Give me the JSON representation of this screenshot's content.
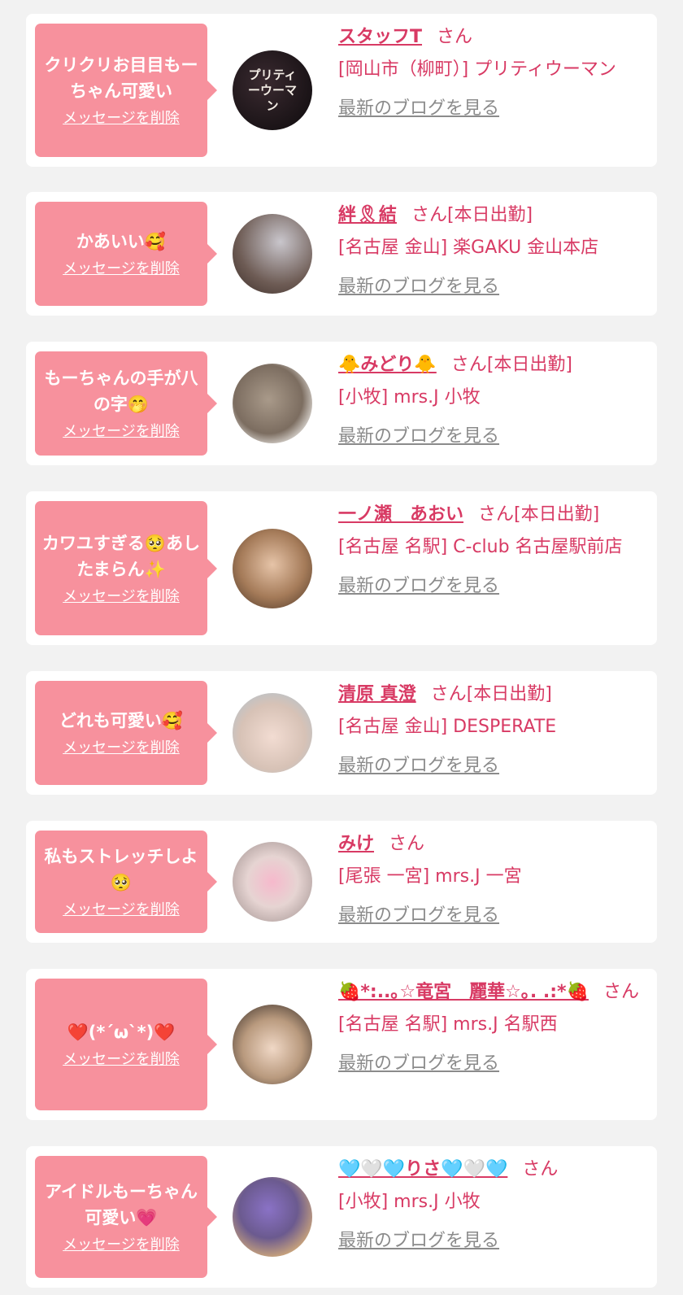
{
  "colors": {
    "bubble": "#f7919d",
    "accent": "#d83a64",
    "link_gray": "#8b8b8b",
    "background": "#f2f2f2",
    "card": "#ffffff"
  },
  "cards": [
    {
      "message": "クリクリお目目もーちゃん可愛い",
      "delete_label": "メッセージを削除",
      "name": "スタッフT",
      "suffix": "さん",
      "status": "",
      "shop": "[岡山市（柳町）] プリティウーマン",
      "blog_label": "最新のブログを見る",
      "avatar_label": "プリティーウーマン"
    },
    {
      "message": "かあいい🥰",
      "delete_label": "メッセージを削除",
      "name": "絆🎗結",
      "suffix": "さん",
      "status": "[本日出勤]",
      "shop": "[名古屋 金山] 楽GAKU 金山本店",
      "blog_label": "最新のブログを見る"
    },
    {
      "message": "もーちゃんの手が八の字🤭",
      "delete_label": "メッセージを削除",
      "name": "🐥みどり🐥",
      "suffix": "さん",
      "status": "[本日出勤]",
      "shop": "[小牧] mrs.J 小牧",
      "blog_label": "最新のブログを見る"
    },
    {
      "message": "カワユすぎる🥺あしたまらん✨",
      "delete_label": "メッセージを削除",
      "name": "一ノ瀬　あおい",
      "suffix": "さん",
      "status": "[本日出勤]",
      "shop": "[名古屋 名駅] C-club 名古屋駅前店",
      "blog_label": "最新のブログを見る"
    },
    {
      "message": "どれも可愛い🥰",
      "delete_label": "メッセージを削除",
      "name": "清原 真澄",
      "suffix": "さん",
      "status": "[本日出勤]",
      "shop": "[名古屋 金山] DESPERATE",
      "blog_label": "最新のブログを見る"
    },
    {
      "message": "私もストレッチしよ🥺",
      "delete_label": "メッセージを削除",
      "name": "みけ",
      "suffix": "さん",
      "status": "",
      "shop": "[尾張 一宮] mrs.J 一宮",
      "blog_label": "最新のブログを見る"
    },
    {
      "message": "❤️(*´ω`*)❤️",
      "delete_label": "メッセージを削除",
      "name": "🍓*:..｡☆竜宮　麗華☆｡. .:*🍓",
      "suffix": "さん",
      "status": "",
      "shop": "[名古屋 名駅] mrs.J 名駅西",
      "blog_label": "最新のブログを見る"
    },
    {
      "message": "アイドルもーちゃん可愛い💗",
      "delete_label": "メッセージを削除",
      "name": "🩵🤍🩵りさ🩵🤍🩵",
      "suffix": "さん",
      "status": "",
      "shop": "[小牧] mrs.J 小牧",
      "blog_label": "最新のブログを見る"
    }
  ]
}
